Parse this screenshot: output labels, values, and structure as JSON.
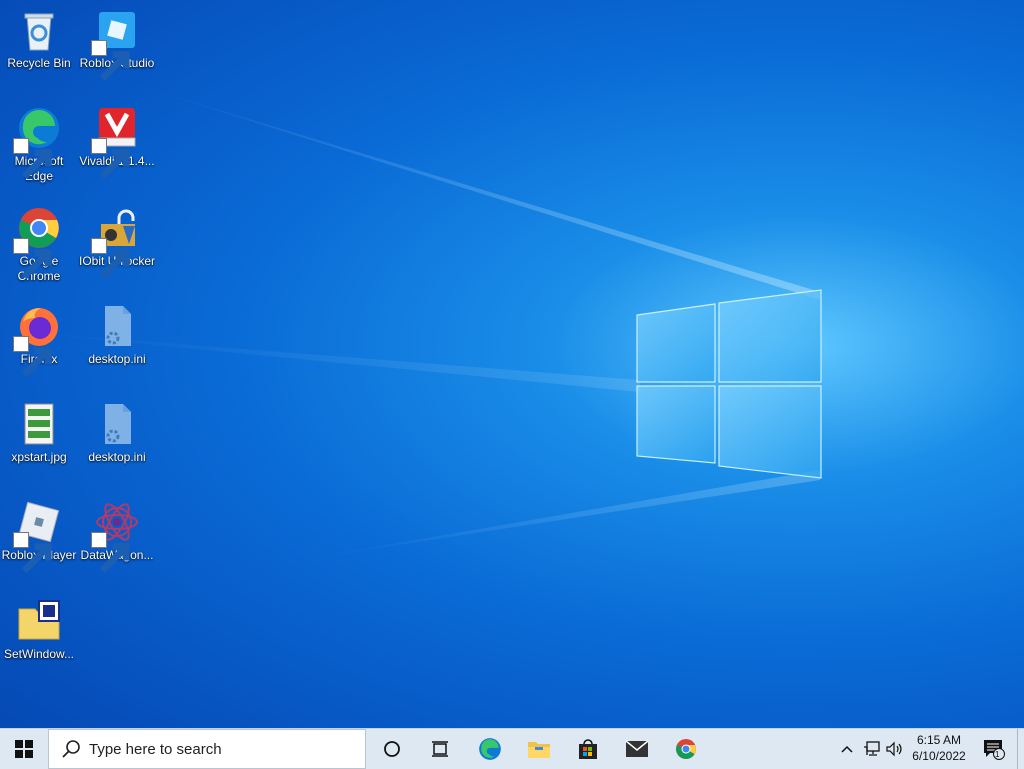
{
  "desktop": {
    "icons": [
      {
        "label": "Recycle Bin",
        "icon": "recycle-bin-icon",
        "shortcut": false
      },
      {
        "label": "Roblox Studio",
        "icon": "roblox-studio-icon",
        "shortcut": true
      },
      {
        "label": "Microsoft Edge",
        "icon": "edge-icon",
        "shortcut": true
      },
      {
        "label": "Vivaldi.1.1.4...",
        "icon": "vivaldi-icon",
        "shortcut": true
      },
      {
        "label": "Google Chrome",
        "icon": "chrome-icon",
        "shortcut": true
      },
      {
        "label": "IObit Unlocker",
        "icon": "iobit-unlocker-icon",
        "shortcut": true
      },
      {
        "label": "Firefox",
        "icon": "firefox-icon",
        "shortcut": true
      },
      {
        "label": "desktop.ini",
        "icon": "ini-file-icon",
        "shortcut": false
      },
      {
        "label": "xpstart.jpg",
        "icon": "image-file-icon",
        "shortcut": false
      },
      {
        "label": "desktop.ini",
        "icon": "ini-file-icon",
        "shortcut": false
      },
      {
        "label": "Roblox Player",
        "icon": "roblox-player-icon",
        "shortcut": true
      },
      {
        "label": "DataWagon...",
        "icon": "datawagon-icon",
        "shortcut": true
      },
      {
        "label": "SetWindow...",
        "icon": "setwindow-icon",
        "shortcut": false
      }
    ]
  },
  "taskbar": {
    "search_placeholder": "Type here to search",
    "pinned": [
      "cortana-icon",
      "task-view-icon",
      "edge-icon",
      "file-explorer-icon",
      "microsoft-store-icon",
      "mail-icon",
      "chrome-icon"
    ],
    "clock_time": "6:15 AM",
    "clock_date": "6/10/2022",
    "notification_count": "1"
  },
  "colors": {
    "taskbar": "#dde8f3",
    "wallpaper": "#0a6bd6"
  }
}
